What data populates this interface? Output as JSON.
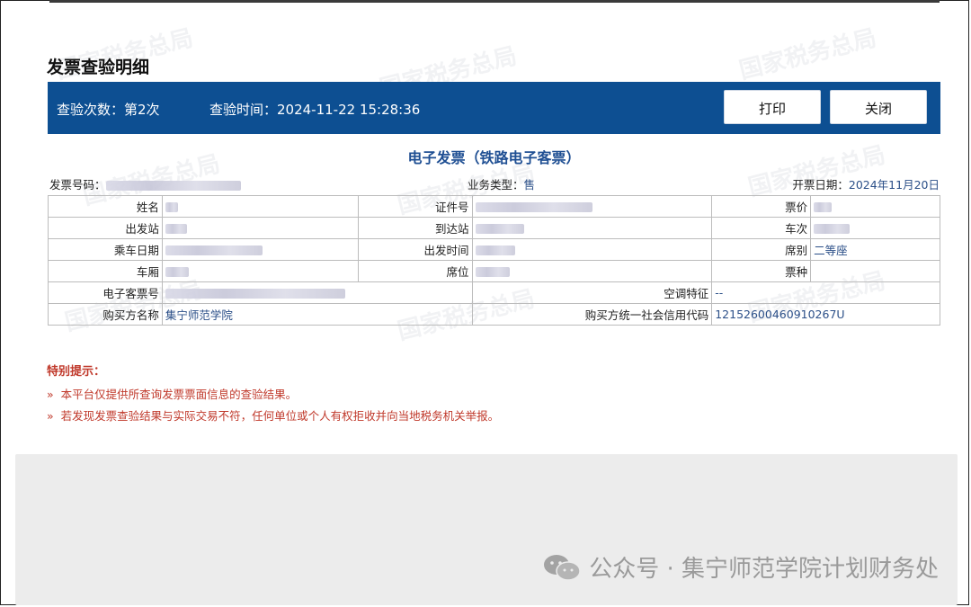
{
  "page": {
    "title": "发票查验明细"
  },
  "header": {
    "check_count_label": "查验次数：第2次",
    "check_time_label": "查验时间：2024-11-22 15:28:36",
    "print_button": "打印",
    "close_button": "关闭"
  },
  "invoice": {
    "title": "电子发票（铁路电子客票）",
    "number_label": "发票号码：",
    "business_type_label": "业务类型：",
    "business_type_value": "售",
    "issue_date_label": "开票日期：",
    "issue_date_value": "2024年11月20日",
    "rows": {
      "name": "姓名",
      "id_number": "证件号",
      "fare": "票价",
      "departure_station": "出发站",
      "arrival_station": "到达站",
      "train_number": "车次",
      "travel_date": "乘车日期",
      "departure_time": "出发时间",
      "seat_class": "席别",
      "seat_class_value": "二等座",
      "car": "车厢",
      "seat": "席位",
      "ticket_type": "票种",
      "ticket_number": "电子客票号",
      "ac_feature": "空调特征",
      "ac_feature_value": "--",
      "buyer_name_label": "购买方名称",
      "buyer_name_value": "集宁师范学院",
      "buyer_credit_code_label": "购买方统一社会信用代码",
      "buyer_credit_code_value": "12152600460910267U"
    }
  },
  "notice": {
    "title": "特别提示：",
    "items": [
      "本平台仅提供所查询发票票面信息的查验结果。",
      "若发现发票查验结果与实际交易不符，任何单位或个人有权拒收并向当地税务机关举报。"
    ],
    "bullet": "»"
  },
  "watermark": {
    "text": "国家税务总局"
  },
  "footer": {
    "wechat_caption": "公众号 · 集宁师范学院计划财务处"
  },
  "colors": {
    "header_blue": "#0d4f92",
    "link_blue": "#1f4f93",
    "notice_red": "#c0392b"
  }
}
